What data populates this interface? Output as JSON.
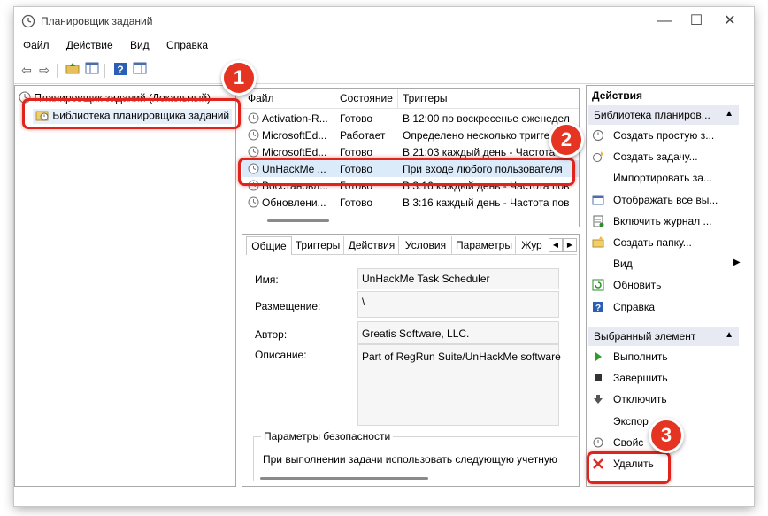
{
  "window": {
    "title": "Планировщик заданий"
  },
  "menu": [
    "Файл",
    "Действие",
    "Вид",
    "Справка"
  ],
  "tree": {
    "root": "Планировщик заданий (Локальный)",
    "child": "Библиотека планировщика заданий"
  },
  "task_list": {
    "columns": [
      "Файл",
      "Состояние",
      "Триггеры"
    ],
    "rows": [
      {
        "name": "Activation-R...",
        "state": "Готово",
        "trigger": "В 12:00 по воскресенье еженедел"
      },
      {
        "name": "MicrosoftEd...",
        "state": "Работает",
        "trigger": "Определено несколько триггер"
      },
      {
        "name": "MicrosoftEd...",
        "state": "Готово",
        "trigger": "В 21:03 каждый день - Частота п"
      },
      {
        "name": "UnHackMe ...",
        "state": "Готово",
        "trigger": "При входе любого пользователя"
      },
      {
        "name": "Восстановл...",
        "state": "Готово",
        "trigger": "В 3:16 каждый день - Частота пов"
      },
      {
        "name": "Обновлени...",
        "state": "Готово",
        "trigger": "В 3:16 каждый день - Частота пов"
      }
    ]
  },
  "details": {
    "tabs": [
      "Общие",
      "Триггеры",
      "Действия",
      "Условия",
      "Параметры",
      "Жур"
    ],
    "name_label": "Имя:",
    "name_value": "UnHackMe Task Scheduler",
    "location_label": "Размещение:",
    "location_value": "\\",
    "author_label": "Автор:",
    "author_value": "Greatis Software, LLC.",
    "desc_label": "Описание:",
    "desc_value": "Part of RegRun Suite/UnHackMe software",
    "security_title": "Параметры безопасности",
    "security_text": "При выполнении задачи использовать следующую учетную"
  },
  "actions": {
    "title": "Действия",
    "section1": "Библиотека планиров...",
    "items1": [
      {
        "icon": "create-basic-task-icon",
        "label": "Создать простую з..."
      },
      {
        "icon": "create-task-icon",
        "label": "Создать задачу..."
      },
      {
        "icon": "",
        "label": "Импортировать за..."
      },
      {
        "icon": "display-running-icon",
        "label": "Отображать все вы..."
      },
      {
        "icon": "enable-log-icon",
        "label": "Включить журнал ..."
      },
      {
        "icon": "new-folder-icon",
        "label": "Создать папку..."
      },
      {
        "icon": "",
        "label": "Вид"
      },
      {
        "icon": "refresh-icon",
        "label": "Обновить"
      },
      {
        "icon": "help-icon",
        "label": "Справка"
      }
    ],
    "section2": "Выбранный элемент",
    "items2": [
      {
        "icon": "run-icon",
        "label": "Выполнить"
      },
      {
        "icon": "end-icon",
        "label": "Завершить"
      },
      {
        "icon": "disable-icon",
        "label": "Отключить"
      },
      {
        "icon": "",
        "label": "Экспор"
      },
      {
        "icon": "properties-icon",
        "label": "Свойс"
      },
      {
        "icon": "delete-icon",
        "label": "Удалить"
      }
    ]
  },
  "callouts": [
    "1",
    "2",
    "3"
  ],
  "colors": {
    "callout": "#e53421",
    "highlight": "#e0241b",
    "section_header": "#e7eaf2"
  }
}
